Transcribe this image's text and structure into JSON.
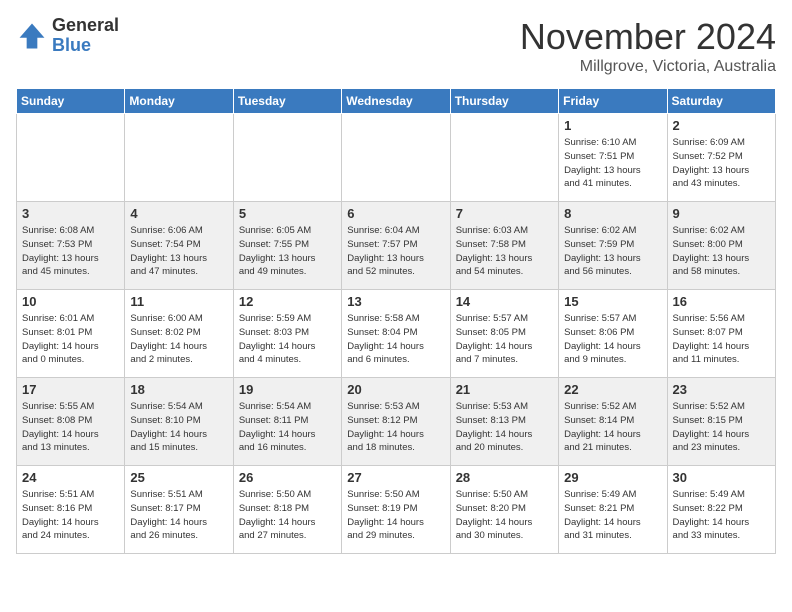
{
  "header": {
    "logo": {
      "line1": "General",
      "line2": "Blue"
    },
    "title": "November 2024",
    "location": "Millgrove, Victoria, Australia"
  },
  "days_of_week": [
    "Sunday",
    "Monday",
    "Tuesday",
    "Wednesday",
    "Thursday",
    "Friday",
    "Saturday"
  ],
  "weeks": [
    [
      {
        "day": "",
        "info": ""
      },
      {
        "day": "",
        "info": ""
      },
      {
        "day": "",
        "info": ""
      },
      {
        "day": "",
        "info": ""
      },
      {
        "day": "",
        "info": ""
      },
      {
        "day": "1",
        "info": "Sunrise: 6:10 AM\nSunset: 7:51 PM\nDaylight: 13 hours\nand 41 minutes."
      },
      {
        "day": "2",
        "info": "Sunrise: 6:09 AM\nSunset: 7:52 PM\nDaylight: 13 hours\nand 43 minutes."
      }
    ],
    [
      {
        "day": "3",
        "info": "Sunrise: 6:08 AM\nSunset: 7:53 PM\nDaylight: 13 hours\nand 45 minutes."
      },
      {
        "day": "4",
        "info": "Sunrise: 6:06 AM\nSunset: 7:54 PM\nDaylight: 13 hours\nand 47 minutes."
      },
      {
        "day": "5",
        "info": "Sunrise: 6:05 AM\nSunset: 7:55 PM\nDaylight: 13 hours\nand 49 minutes."
      },
      {
        "day": "6",
        "info": "Sunrise: 6:04 AM\nSunset: 7:57 PM\nDaylight: 13 hours\nand 52 minutes."
      },
      {
        "day": "7",
        "info": "Sunrise: 6:03 AM\nSunset: 7:58 PM\nDaylight: 13 hours\nand 54 minutes."
      },
      {
        "day": "8",
        "info": "Sunrise: 6:02 AM\nSunset: 7:59 PM\nDaylight: 13 hours\nand 56 minutes."
      },
      {
        "day": "9",
        "info": "Sunrise: 6:02 AM\nSunset: 8:00 PM\nDaylight: 13 hours\nand 58 minutes."
      }
    ],
    [
      {
        "day": "10",
        "info": "Sunrise: 6:01 AM\nSunset: 8:01 PM\nDaylight: 14 hours\nand 0 minutes."
      },
      {
        "day": "11",
        "info": "Sunrise: 6:00 AM\nSunset: 8:02 PM\nDaylight: 14 hours\nand 2 minutes."
      },
      {
        "day": "12",
        "info": "Sunrise: 5:59 AM\nSunset: 8:03 PM\nDaylight: 14 hours\nand 4 minutes."
      },
      {
        "day": "13",
        "info": "Sunrise: 5:58 AM\nSunset: 8:04 PM\nDaylight: 14 hours\nand 6 minutes."
      },
      {
        "day": "14",
        "info": "Sunrise: 5:57 AM\nSunset: 8:05 PM\nDaylight: 14 hours\nand 7 minutes."
      },
      {
        "day": "15",
        "info": "Sunrise: 5:57 AM\nSunset: 8:06 PM\nDaylight: 14 hours\nand 9 minutes."
      },
      {
        "day": "16",
        "info": "Sunrise: 5:56 AM\nSunset: 8:07 PM\nDaylight: 14 hours\nand 11 minutes."
      }
    ],
    [
      {
        "day": "17",
        "info": "Sunrise: 5:55 AM\nSunset: 8:08 PM\nDaylight: 14 hours\nand 13 minutes."
      },
      {
        "day": "18",
        "info": "Sunrise: 5:54 AM\nSunset: 8:10 PM\nDaylight: 14 hours\nand 15 minutes."
      },
      {
        "day": "19",
        "info": "Sunrise: 5:54 AM\nSunset: 8:11 PM\nDaylight: 14 hours\nand 16 minutes."
      },
      {
        "day": "20",
        "info": "Sunrise: 5:53 AM\nSunset: 8:12 PM\nDaylight: 14 hours\nand 18 minutes."
      },
      {
        "day": "21",
        "info": "Sunrise: 5:53 AM\nSunset: 8:13 PM\nDaylight: 14 hours\nand 20 minutes."
      },
      {
        "day": "22",
        "info": "Sunrise: 5:52 AM\nSunset: 8:14 PM\nDaylight: 14 hours\nand 21 minutes."
      },
      {
        "day": "23",
        "info": "Sunrise: 5:52 AM\nSunset: 8:15 PM\nDaylight: 14 hours\nand 23 minutes."
      }
    ],
    [
      {
        "day": "24",
        "info": "Sunrise: 5:51 AM\nSunset: 8:16 PM\nDaylight: 14 hours\nand 24 minutes."
      },
      {
        "day": "25",
        "info": "Sunrise: 5:51 AM\nSunset: 8:17 PM\nDaylight: 14 hours\nand 26 minutes."
      },
      {
        "day": "26",
        "info": "Sunrise: 5:50 AM\nSunset: 8:18 PM\nDaylight: 14 hours\nand 27 minutes."
      },
      {
        "day": "27",
        "info": "Sunrise: 5:50 AM\nSunset: 8:19 PM\nDaylight: 14 hours\nand 29 minutes."
      },
      {
        "day": "28",
        "info": "Sunrise: 5:50 AM\nSunset: 8:20 PM\nDaylight: 14 hours\nand 30 minutes."
      },
      {
        "day": "29",
        "info": "Sunrise: 5:49 AM\nSunset: 8:21 PM\nDaylight: 14 hours\nand 31 minutes."
      },
      {
        "day": "30",
        "info": "Sunrise: 5:49 AM\nSunset: 8:22 PM\nDaylight: 14 hours\nand 33 minutes."
      }
    ]
  ]
}
